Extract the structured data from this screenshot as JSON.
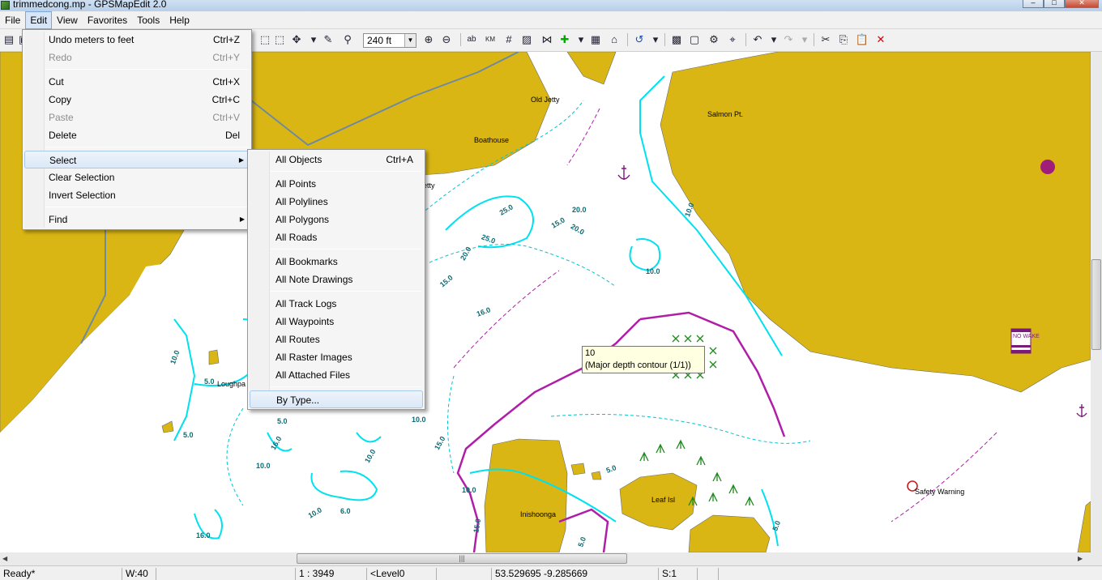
{
  "window": {
    "title": "trimmedcong.mp - GPSMapEdit 2.0",
    "controls": {
      "minimize": "–",
      "maximize": "□",
      "close": "✕"
    }
  },
  "menubar": [
    "File",
    "Edit",
    "View",
    "Favorites",
    "Tools",
    "Help"
  ],
  "toolbar": {
    "scale_value": "240 ft",
    "icons": [
      "open-icon",
      "save-icon",
      "select-icon",
      "move-icon",
      "zoom-in-icon",
      "zoom-out-icon",
      "label-icon",
      "grid-icon",
      "undo-icon",
      "redo-icon",
      "cut-icon",
      "copy-icon",
      "paste-icon",
      "delete-icon"
    ],
    "label_ab": "ab",
    "label_km": "KM"
  },
  "edit_menu": [
    {
      "label": "Undo meters to feet",
      "shortcut": "Ctrl+Z",
      "disabled": false
    },
    {
      "label": "Redo",
      "shortcut": "Ctrl+Y",
      "disabled": true
    },
    {
      "label": "Cut",
      "shortcut": "Ctrl+X",
      "disabled": false
    },
    {
      "label": "Copy",
      "shortcut": "Ctrl+C",
      "disabled": false
    },
    {
      "label": "Paste",
      "shortcut": "Ctrl+V",
      "disabled": true
    },
    {
      "label": "Delete",
      "shortcut": "Del",
      "disabled": false
    },
    {
      "label": "Select",
      "shortcut": "",
      "submenu": true
    },
    {
      "label": "Clear Selection",
      "shortcut": ""
    },
    {
      "label": "Invert Selection",
      "shortcut": ""
    },
    {
      "label": "Find",
      "shortcut": "",
      "submenu": true
    }
  ],
  "select_submenu": [
    {
      "label": "All Objects",
      "shortcut": "Ctrl+A"
    },
    {
      "label": "All Points"
    },
    {
      "label": "All Polylines"
    },
    {
      "label": "All Polygons"
    },
    {
      "label": "All Roads"
    },
    {
      "label": "All Bookmarks"
    },
    {
      "label": "All Note Drawings"
    },
    {
      "label": "All Track Logs"
    },
    {
      "label": "All Waypoints"
    },
    {
      "label": "All Routes"
    },
    {
      "label": "All Raster Images"
    },
    {
      "label": "All Attached Files"
    },
    {
      "label": "By Type..."
    }
  ],
  "tooltip": {
    "line1": "10",
    "line2": "(Major depth contour (1/1))"
  },
  "map": {
    "place_labels": [
      "Old Jetty",
      "Boathouse",
      "Salmon Pt.",
      "etty",
      "Loughpa",
      "Leaf Isl",
      "Inishoonga",
      "Safety Warning"
    ],
    "depth_labels": [
      "25.0",
      "15.0",
      "20.0",
      "25.0",
      "20.0",
      "15.0",
      "10.0",
      "10.0",
      "16.0",
      "10.0",
      "10.0",
      "5.0",
      "5.0",
      "16.0",
      "10.0",
      "10.0",
      "15.0",
      "10.0",
      "5.0",
      "20.0",
      "16.0",
      "6.0",
      "15.0",
      "5.0",
      "5.0",
      "5.0",
      "10.0"
    ],
    "no_wake_text": "NO WAKE",
    "land_color": "#dab615",
    "depth_contour_color": "#00e1f0",
    "route_color": "#b01ea8"
  },
  "statusbar": {
    "status": "Ready*",
    "width": "W:40",
    "scale": "1 : 3949",
    "level": "<Level0",
    "coords": "53.529695 -9.285669",
    "selection": "S:1"
  }
}
